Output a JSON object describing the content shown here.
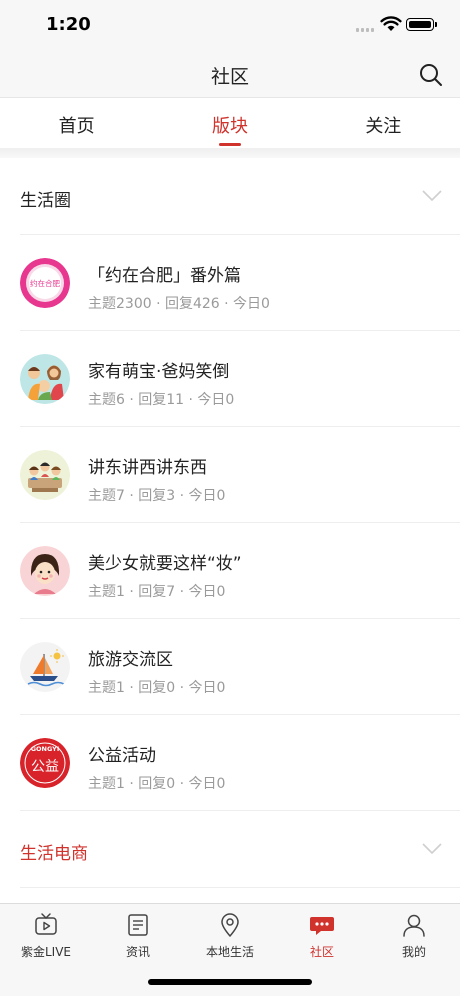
{
  "status_bar": {
    "time": "1:20"
  },
  "nav": {
    "title": "社区"
  },
  "tabs": [
    {
      "label": "首页",
      "active": false
    },
    {
      "label": "版块",
      "active": true
    },
    {
      "label": "关注",
      "active": false
    }
  ],
  "sections": [
    {
      "title": "生活圈",
      "title_color": "#222222"
    },
    {
      "title": "生活电商",
      "title_color": "#d0322c"
    }
  ],
  "boards": [
    {
      "name": "「约在合肥」番外篇",
      "meta": "主题2300 · 回复426 · 今日0",
      "icon": "yue-zai-hefei-logo-icon"
    },
    {
      "name": "家有萌宝·爸妈笑倒",
      "meta": "主题6 · 回复11 · 今日0",
      "icon": "family-cartoon-icon"
    },
    {
      "name": "讲东讲西讲东西",
      "meta": "主题7 · 回复3 · 今日0",
      "icon": "chat-group-cartoon-icon"
    },
    {
      "name": "美少女就要这样“妆”",
      "meta": "主题1 · 回复7 · 今日0",
      "icon": "girl-makeup-cartoon-icon"
    },
    {
      "name": "旅游交流区",
      "meta": "主题1 · 回复0 · 今日0",
      "icon": "sailboat-icon"
    },
    {
      "name": "公益活动",
      "meta": "主题1 · 回复0 · 今日0",
      "icon": "gongyi-logo-icon"
    }
  ],
  "icon_text": {
    "yue": "约在合肥",
    "gongyi_top": "GONGYI",
    "gongyi_main": "公益"
  },
  "tabbar": [
    {
      "label": "紫金LIVE",
      "icon": "tv-play-icon",
      "active": false
    },
    {
      "label": "资讯",
      "icon": "news-list-icon",
      "active": false
    },
    {
      "label": "本地生活",
      "icon": "location-pin-icon",
      "active": false
    },
    {
      "label": "社区",
      "icon": "community-chat-icon",
      "active": true
    },
    {
      "label": "我的",
      "icon": "person-icon",
      "active": false
    }
  ],
  "colors": {
    "accent": "#d0322c",
    "text": "#222222",
    "meta": "#9a9a9a"
  }
}
